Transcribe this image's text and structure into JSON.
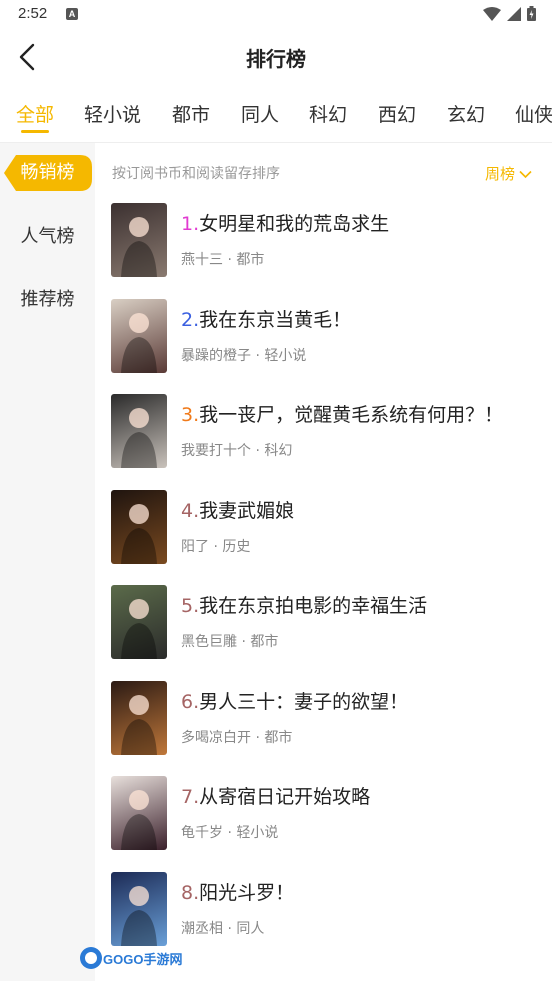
{
  "status_bar": {
    "time": "2:52",
    "notification_icon": "A"
  },
  "header": {
    "title": "排行榜"
  },
  "categories": [
    "全部",
    "轻小说",
    "都市",
    "同人",
    "科幻",
    "西幻",
    "玄幻",
    "仙侠"
  ],
  "active_category": "全部",
  "sidebar": [
    "畅销榜",
    "人气榜",
    "推荐榜"
  ],
  "active_sidebar": "畅销榜",
  "main": {
    "sort_desc": "按订阅书币和阅读留存排序",
    "period": "周榜"
  },
  "books": [
    {
      "rank": "1.",
      "title": "女明星和我的荒岛求生",
      "author": "燕十三",
      "genre": "都市",
      "rank_color": "#e13ad1"
    },
    {
      "rank": "2.",
      "title": "我在东京当黄毛！",
      "author": "暴躁的橙子",
      "genre": "轻小说",
      "rank_color": "#3a5fe0"
    },
    {
      "rank": "3.",
      "title": "我一丧尸，觉醒黄毛系统有何用？！",
      "author": "我要打十个",
      "genre": "科幻",
      "rank_color": "#f07a1a"
    },
    {
      "rank": "4.",
      "title": "我妻武媚娘",
      "author": "阳了",
      "genre": "历史",
      "rank_color": "#a56464"
    },
    {
      "rank": "5.",
      "title": "我在东京拍电影的幸福生活",
      "author": "黑色巨雕",
      "genre": "都市",
      "rank_color": "#a56464"
    },
    {
      "rank": "6.",
      "title": "男人三十：妻子的欲望！",
      "author": "多喝凉白开",
      "genre": "都市",
      "rank_color": "#a56464"
    },
    {
      "rank": "7.",
      "title": "从寄宿日记开始攻略",
      "author": "龟千岁",
      "genre": "轻小说",
      "rank_color": "#a56464"
    },
    {
      "rank": "8.",
      "title": "阳光斗罗！",
      "author": "潮丞相",
      "genre": "同人",
      "rank_color": "#a56464"
    }
  ],
  "watermark": {
    "text": "GOGO手游网"
  },
  "colors": {
    "accent": "#f5b800",
    "sidebar_bg": "#f6f6f6"
  }
}
